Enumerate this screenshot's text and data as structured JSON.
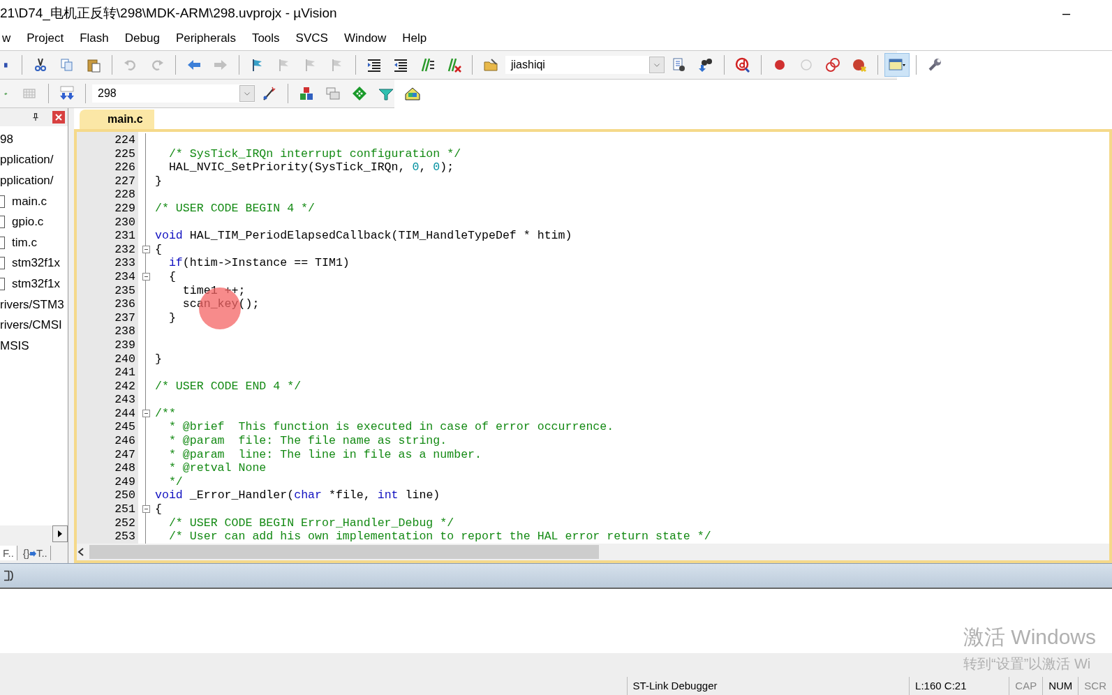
{
  "window": {
    "title": "21\\D74_电机正反转\\298\\MDK-ARM\\298.uvprojx - µVision",
    "minimize": "–"
  },
  "menu": [
    "w",
    "Project",
    "Flash",
    "Debug",
    "Peripherals",
    "Tools",
    "SVCS",
    "Window",
    "Help"
  ],
  "toolbar": {
    "target_combo": "jiashiqi",
    "build_combo": "298"
  },
  "project_panel": {
    "tree": [
      {
        "label": "98",
        "children": [
          {
            "label": "pplication/"
          },
          {
            "label": "pplication/",
            "children": [
              {
                "label": "main.c",
                "kind": "file"
              },
              {
                "label": "gpio.c",
                "kind": "file"
              },
              {
                "label": "tim.c",
                "kind": "file"
              },
              {
                "label": "stm32f1x",
                "kind": "file"
              },
              {
                "label": "stm32f1x",
                "kind": "file"
              }
            ]
          },
          {
            "label": "rivers/STM3"
          },
          {
            "label": "rivers/CMSI"
          },
          {
            "label": "MSIS"
          }
        ]
      }
    ],
    "tabs": [
      {
        "label": "F..",
        "selected": true
      },
      {
        "label": "{}",
        "label2": "T..",
        "selected": false
      }
    ]
  },
  "editor": {
    "tabs": [
      {
        "label": "main.c",
        "selected": true
      }
    ],
    "lines": [
      {
        "num": "224",
        "fold": false
      },
      {
        "num": "225",
        "fold": false,
        "tokens": [
          {
            "text": "  /* SysTick_IRQn interrupt configuration */",
            "kind": "comment"
          }
        ]
      },
      {
        "num": "226",
        "fold": false,
        "tokens": [
          {
            "text": "  HAL_NVIC_SetPriority(SysTick_IRQn, ",
            "kind": "plain"
          },
          {
            "text": "0",
            "kind": "number"
          },
          {
            "text": ", ",
            "kind": "plain"
          },
          {
            "text": "0",
            "kind": "number"
          },
          {
            "text": ");",
            "kind": "plain"
          }
        ]
      },
      {
        "num": "227",
        "fold": false,
        "tokens": [
          {
            "text": "}",
            "kind": "plain"
          }
        ]
      },
      {
        "num": "228",
        "fold": false
      },
      {
        "num": "229",
        "fold": false,
        "tokens": [
          {
            "text": "/* USER CODE BEGIN 4 */",
            "kind": "comment"
          }
        ]
      },
      {
        "num": "230",
        "fold": false
      },
      {
        "num": "231",
        "fold": false,
        "tokens": [
          {
            "text": "void",
            "kind": "keyword"
          },
          {
            "text": " HAL_TIM_PeriodElapsedCallback(TIM_HandleTypeDef * htim)",
            "kind": "plain"
          }
        ]
      },
      {
        "num": "232",
        "fold": true,
        "tokens": [
          {
            "text": "{",
            "kind": "plain"
          }
        ]
      },
      {
        "num": "233",
        "fold": false,
        "tokens": [
          {
            "text": "  if",
            "kind": "keyword"
          },
          {
            "text": "(htim->Instance == TIM1)",
            "kind": "plain"
          }
        ]
      },
      {
        "num": "234",
        "fold": true,
        "tokens": [
          {
            "text": "  {",
            "kind": "plain"
          }
        ]
      },
      {
        "num": "235",
        "fold": false,
        "tokens": [
          {
            "text": "    time1 ++;",
            "kind": "plain"
          }
        ]
      },
      {
        "num": "236",
        "fold": false,
        "tokens": [
          {
            "text": "    scan_key();",
            "kind": "plain"
          }
        ]
      },
      {
        "num": "237",
        "fold": false,
        "tokens": [
          {
            "text": "  }",
            "kind": "plain"
          }
        ]
      },
      {
        "num": "238",
        "fold": false
      },
      {
        "num": "239",
        "fold": false
      },
      {
        "num": "240",
        "fold": false,
        "tokens": [
          {
            "text": "}",
            "kind": "plain"
          }
        ]
      },
      {
        "num": "241",
        "fold": false
      },
      {
        "num": "242",
        "fold": false,
        "tokens": [
          {
            "text": "/* USER CODE END 4 */",
            "kind": "comment"
          }
        ]
      },
      {
        "num": "243",
        "fold": false
      },
      {
        "num": "244",
        "fold": true,
        "tokens": [
          {
            "text": "/**",
            "kind": "comment"
          }
        ]
      },
      {
        "num": "245",
        "fold": false,
        "tokens": [
          {
            "text": "  * @brief  This function is executed in case of error occurrence.",
            "kind": "comment"
          }
        ]
      },
      {
        "num": "246",
        "fold": false,
        "tokens": [
          {
            "text": "  * @param  file: The file name as string.",
            "kind": "comment"
          }
        ]
      },
      {
        "num": "247",
        "fold": false,
        "tokens": [
          {
            "text": "  * @param  line: The line in file as a number.",
            "kind": "comment"
          }
        ]
      },
      {
        "num": "248",
        "fold": false,
        "tokens": [
          {
            "text": "  * @retval None",
            "kind": "comment"
          }
        ]
      },
      {
        "num": "249",
        "fold": false,
        "tokens": [
          {
            "text": "  */",
            "kind": "comment"
          }
        ]
      },
      {
        "num": "250",
        "fold": false,
        "tokens": [
          {
            "text": "void",
            "kind": "keyword"
          },
          {
            "text": " _Error_Handler(",
            "kind": "plain"
          },
          {
            "text": "char",
            "kind": "keyword"
          },
          {
            "text": " *file, ",
            "kind": "plain"
          },
          {
            "text": "int",
            "kind": "keyword"
          },
          {
            "text": " line)",
            "kind": "plain"
          }
        ]
      },
      {
        "num": "251",
        "fold": true,
        "tokens": [
          {
            "text": "{",
            "kind": "plain"
          }
        ]
      },
      {
        "num": "252",
        "fold": false,
        "tokens": [
          {
            "text": "  /* USER CODE BEGIN Error_Handler_Debug */",
            "kind": "comment"
          }
        ]
      },
      {
        "num": "253",
        "fold": false,
        "tokens": [
          {
            "text": "  /* User can add his own implementation to report the HAL error return state */",
            "kind": "comment"
          }
        ]
      }
    ]
  },
  "activation_notice": {
    "title": "激活 Windows",
    "subtitle": "转到“设置”以激活 Wi"
  },
  "status_bar": [
    "ST-Link Debugger",
    "L:160 C:21",
    "CAP",
    "NUM",
    "SCR"
  ]
}
